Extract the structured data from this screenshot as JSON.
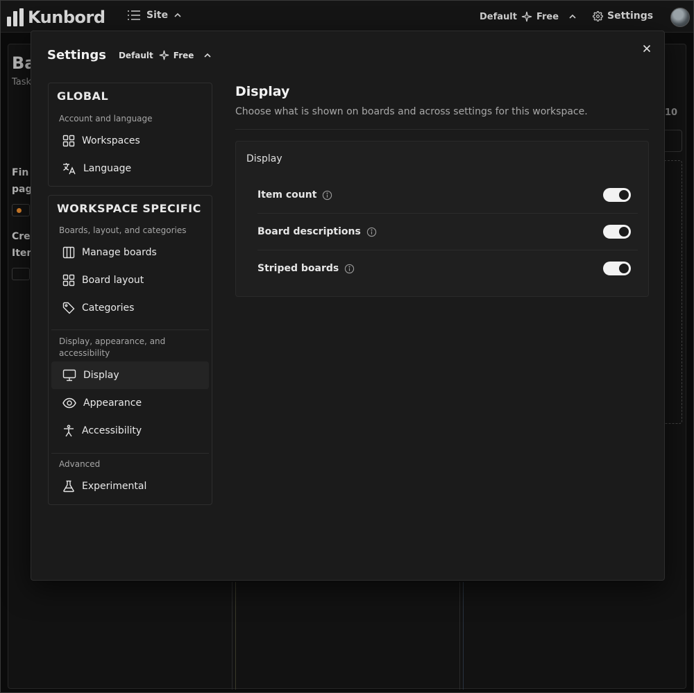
{
  "topbar": {
    "brand": "Kunbord",
    "site_label": "Site",
    "plan_workspace": "Default",
    "plan_tier": "Free",
    "settings_label": "Settings"
  },
  "background": {
    "title_partial": "Ba",
    "subtitle_partial": "Task",
    "card1_line1": "Fin",
    "card1_line2": "pag",
    "card2_line1": "Cre",
    "card2_line2": "Item",
    "badge_count": "10"
  },
  "modal": {
    "title": "Settings",
    "plan_workspace": "Default",
    "plan_tier": "Free"
  },
  "nav": {
    "global": {
      "heading": "GLOBAL",
      "caption": "Account and language",
      "items": [
        {
          "label": "Workspaces",
          "icon": "grid-icon"
        },
        {
          "label": "Language",
          "icon": "translate-icon"
        }
      ]
    },
    "workspace": {
      "heading": "WORKSPACE SPECIFIC",
      "caption_boards": "Boards, layout, and categories",
      "items_boards": [
        {
          "label": "Manage boards",
          "icon": "columns-icon"
        },
        {
          "label": "Board layout",
          "icon": "grid-icon"
        },
        {
          "label": "Categories",
          "icon": "tag-icon"
        }
      ],
      "caption_display": "Display, appearance, and accessibility",
      "items_display": [
        {
          "label": "Display",
          "icon": "monitor-icon"
        },
        {
          "label": "Appearance",
          "icon": "eye-icon"
        },
        {
          "label": "Accessibility",
          "icon": "person-icon"
        }
      ],
      "caption_advanced": "Advanced",
      "items_advanced": [
        {
          "label": "Experimental",
          "icon": "flask-icon"
        }
      ]
    }
  },
  "content": {
    "title": "Display",
    "description": "Choose what is shown on boards and across settings for this workspace.",
    "card_title": "Display",
    "rows": [
      {
        "label": "Item count",
        "enabled": true
      },
      {
        "label": "Board descriptions",
        "enabled": true
      },
      {
        "label": "Striped boards",
        "enabled": true
      }
    ]
  },
  "colors": {
    "background": "#0b0b0b",
    "modal": "#1b1b1b",
    "card": "#1f1f1f",
    "toggle_on": "#f2f2f2",
    "accent_orange": "#d9822b"
  }
}
